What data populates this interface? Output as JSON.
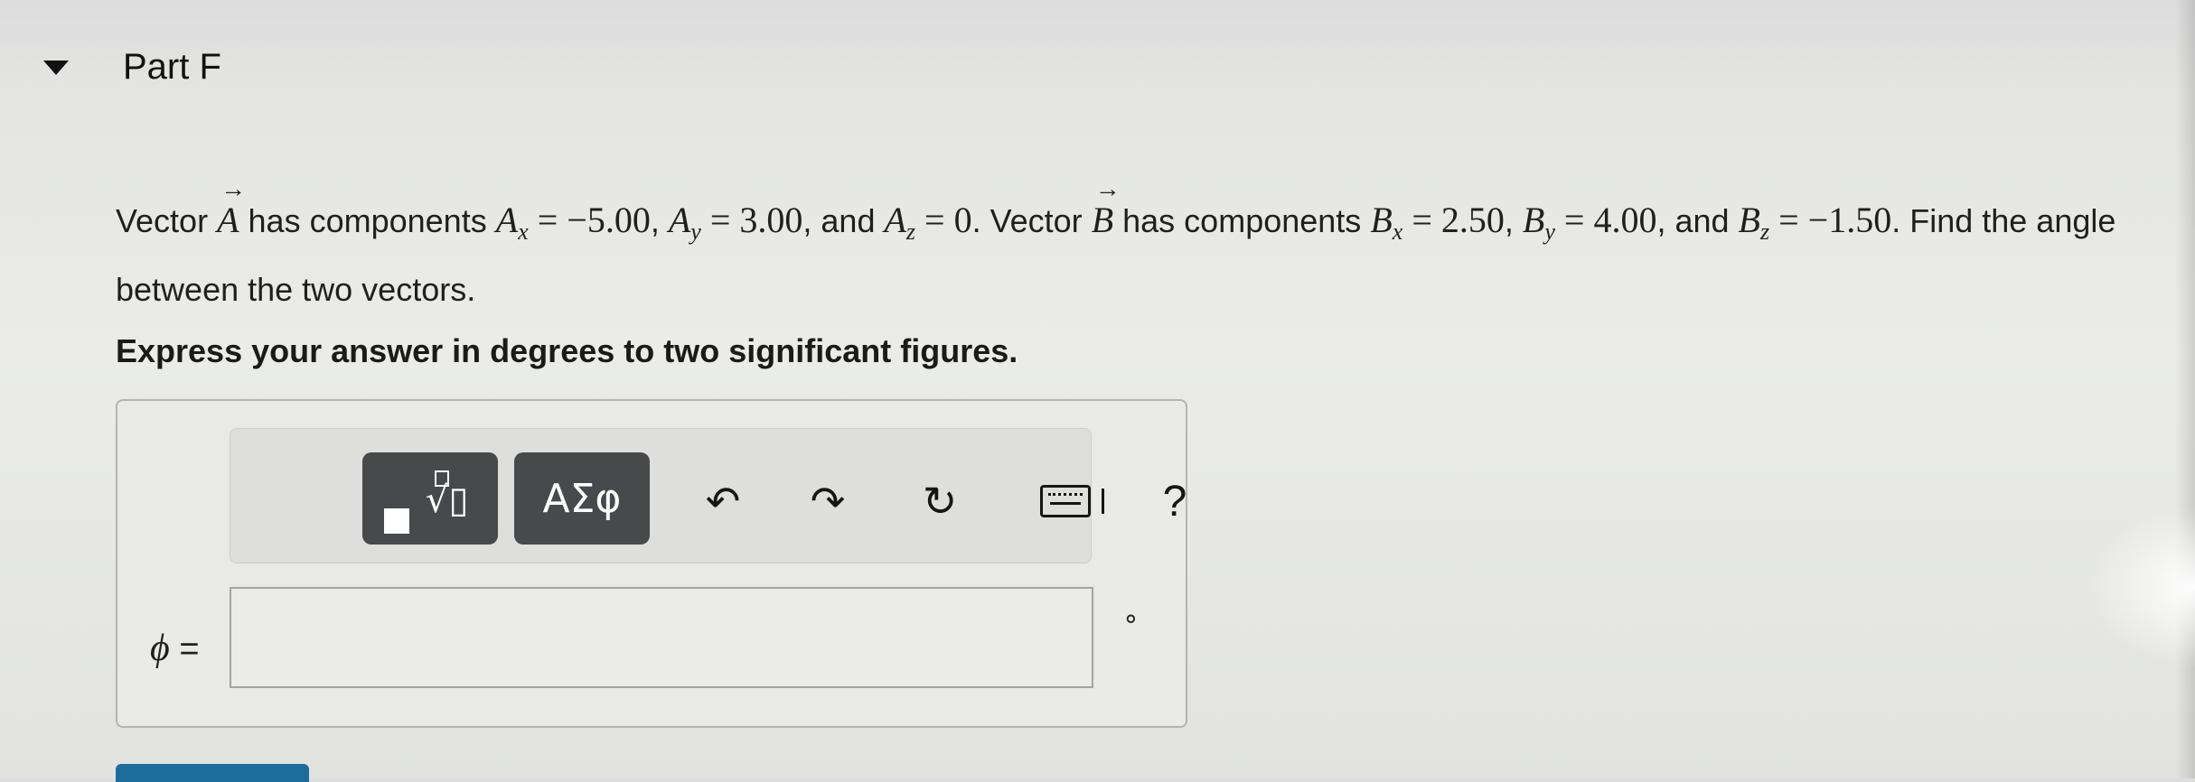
{
  "part": {
    "title": "Part F"
  },
  "problem": {
    "word_vector": "Vector",
    "vec_a": "A",
    "has_components": "has components",
    "ax_label": "A",
    "ax_sub": "x",
    "ax_value": "−5.00",
    "ay_label": "A",
    "ay_sub": "y",
    "ay_value": "3.00",
    "az_label": "A",
    "az_sub": "z",
    "az_value": "0",
    "and_1": ", and",
    "vector_b_intro": ". Vector",
    "vec_b": "B",
    "has_components_2": "has components",
    "bx_label": "B",
    "bx_sub": "x",
    "bx_value": "2.50",
    "by_label": "B",
    "by_sub": "y",
    "by_value": "4.00",
    "and_2": ", and",
    "bz_label": "B",
    "bz_sub": "z",
    "bz_value": "−1.50",
    "question_tail": ". Find the angle between the two vectors."
  },
  "instruction": "Express your answer in degrees to two significant figures.",
  "toolbar": {
    "symbols_label": "ΑΣφ",
    "undo_icon": "↶",
    "redo_icon": "↷",
    "reset_icon": "↻",
    "help_label": "?"
  },
  "answer": {
    "variable": "ϕ",
    "equals": "=",
    "value": "",
    "unit": "∘"
  }
}
